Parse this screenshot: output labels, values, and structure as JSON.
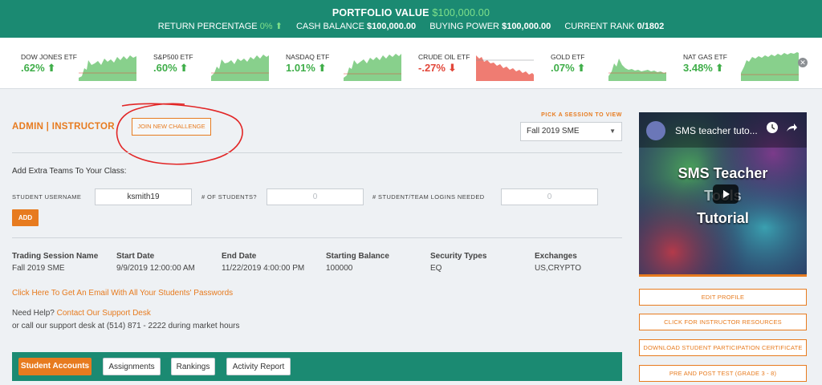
{
  "topbar": {
    "portfolio_label": "PORTFOLIO VALUE",
    "portfolio_value": "$100,000.00",
    "return_label": "RETURN PERCENTAGE",
    "return_value": "0%",
    "cash_label": "CASH BALANCE",
    "cash_value": "$100,000.00",
    "buying_label": "BUYING POWER",
    "buying_value": "$100,000.00",
    "rank_label": "CURRENT RANK",
    "rank_value": "0/1802"
  },
  "tickers": [
    {
      "name": "DOW JONES ETF",
      "value": ".62%",
      "trend": "up"
    },
    {
      "name": "S&P500 ETF",
      "value": ".60%",
      "trend": "up"
    },
    {
      "name": "NASDAQ ETF",
      "value": "1.01%",
      "trend": "up"
    },
    {
      "name": "CRUDE OIL ETF",
      "value": "-.27%",
      "trend": "down"
    },
    {
      "name": "GOLD ETF",
      "value": ".07%",
      "trend": "up"
    },
    {
      "name": "NAT GAS ETF",
      "value": "3.48%",
      "trend": "up"
    }
  ],
  "header": {
    "admin_title": "ADMIN | INSTRUCTOR",
    "join_label": "JOIN NEW CHALLENGE",
    "session_label": "PICK A SESSION TO VIEW",
    "session_value": "Fall 2019 SME"
  },
  "add_teams": {
    "title": "Add Extra Teams To Your Class:",
    "username_label": "STUDENT USERNAME",
    "username_value": "ksmith19",
    "students_label": "# OF STUDENTS?",
    "students_value": "0",
    "logins_label": "# STUDENT/TEAM LOGINS NEEDED",
    "logins_value": "0",
    "add_label": "ADD"
  },
  "session_info": {
    "headers": [
      "Trading Session Name",
      "Start Date",
      "End Date",
      "Starting Balance",
      "Security Types",
      "Exchanges"
    ],
    "values": [
      "Fall 2019 SME",
      "9/9/2019 12:00:00 AM",
      "11/22/2019 4:00:00 PM",
      "100000",
      "EQ",
      "US,CRYPTO"
    ]
  },
  "links": {
    "passwords": "Click Here To Get An Email With All Your Students' Passwords",
    "help_prefix": "Need Help?",
    "help_link": "Contact Our Support Desk",
    "help_phone": "or call our support desk at (514) 871 - 2222 during market hours"
  },
  "tabs": [
    "Student Accounts",
    "Assignments",
    "Rankings",
    "Activity Report"
  ],
  "video": {
    "title": "SMS teacher tuto...",
    "line1": "SMS Teacher",
    "line2": "Tools",
    "line3": "Tutorial"
  },
  "sidebar_buttons": [
    "EDIT PROFILE",
    "CLICK FOR INSTRUCTOR RESOURCES",
    "DOWNLOAD STUDENT PARTICIPATION CERTIFICATE",
    "PRE AND POST TEST (GRADE 3 - 8)"
  ],
  "colors": {
    "accent": "#e77b1f",
    "brand": "#1b8a72",
    "up": "#3fae49",
    "down": "#e2473a"
  }
}
